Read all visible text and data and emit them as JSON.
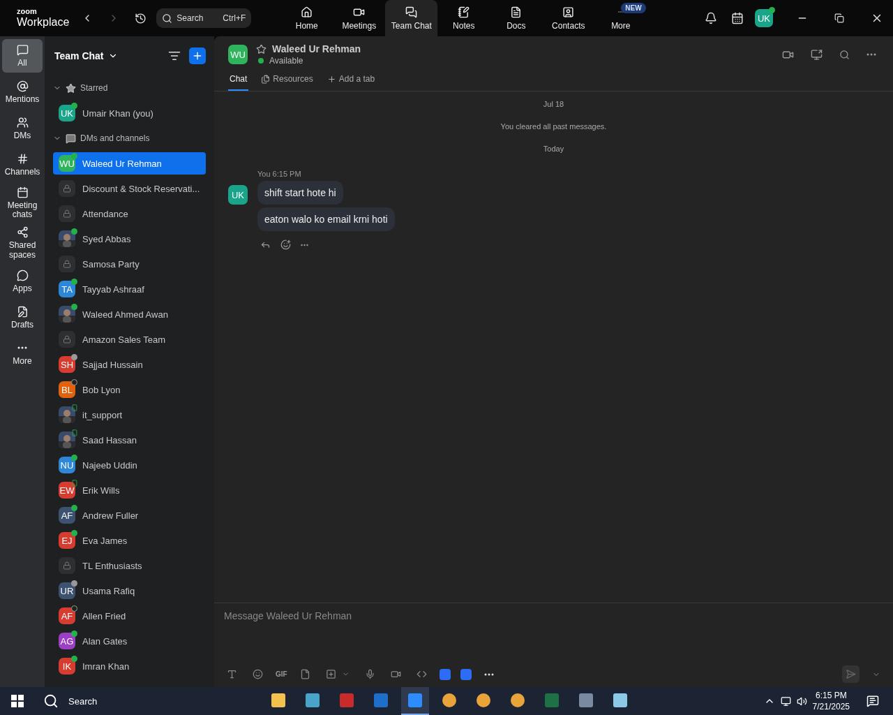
{
  "app": {
    "logo_top": "zoom",
    "logo_bottom": "Workplace"
  },
  "search": {
    "placeholder": "Search",
    "shortcut": "Ctrl+F"
  },
  "nav": [
    {
      "label": "Home",
      "selected": false
    },
    {
      "label": "Meetings",
      "selected": false
    },
    {
      "label": "Team Chat",
      "selected": true
    },
    {
      "label": "Notes",
      "selected": false
    },
    {
      "label": "Docs",
      "selected": false
    },
    {
      "label": "Contacts",
      "selected": false
    },
    {
      "label": "More",
      "selected": false,
      "badge": "NEW"
    }
  ],
  "profile": {
    "initials": "UK"
  },
  "rail": [
    {
      "label": "All",
      "selected": true
    },
    {
      "label": "Mentions",
      "selected": false
    },
    {
      "label": "DMs",
      "selected": false
    },
    {
      "label": "Channels",
      "selected": false
    },
    {
      "label": "Meeting chats",
      "selected": false
    },
    {
      "label": "Shared spaces",
      "selected": false
    },
    {
      "label": "Apps",
      "selected": false
    },
    {
      "label": "Drafts",
      "selected": false
    },
    {
      "label": "More",
      "selected": false
    }
  ],
  "sidebar": {
    "title": "Team Chat",
    "sections": [
      {
        "label": "Starred",
        "expanded": true,
        "items": [
          {
            "name": "Umair Khan (you)",
            "kind": "initials",
            "initials": "UK",
            "color": "#1aa58a",
            "presence": {
              "kind": "online"
            },
            "selected": false
          }
        ]
      },
      {
        "label": "DMs and channels",
        "expanded": true,
        "items": [
          {
            "name": "Waleed Ur Rehman",
            "kind": "initials",
            "initials": "WU",
            "color": "#2fb35c",
            "presence": {
              "kind": "online"
            },
            "selected": true
          },
          {
            "name": "Discount & Stock Reservati...",
            "kind": "channel",
            "selected": false
          },
          {
            "name": "Attendance",
            "kind": "channel",
            "selected": false
          },
          {
            "name": "Syed Abbas",
            "kind": "picture",
            "presence": {
              "kind": "online"
            },
            "selected": false
          },
          {
            "name": "Samosa Party",
            "kind": "channel",
            "selected": false
          },
          {
            "name": "Tayyab Ashraaf",
            "kind": "initials",
            "initials": "TA",
            "color": "#2d86d6",
            "presence": {
              "kind": "online"
            },
            "selected": false
          },
          {
            "name": "Waleed Ahmed Awan",
            "kind": "picture",
            "presence": {
              "kind": "online"
            },
            "selected": false
          },
          {
            "name": "Amazon Sales Team",
            "kind": "channel",
            "selected": false
          },
          {
            "name": "Sajjad Hussain",
            "kind": "initials",
            "initials": "SH",
            "color": "#d63c2f",
            "presence": {
              "kind": "away"
            },
            "selected": false
          },
          {
            "name": "Bob Lyon",
            "kind": "initials",
            "initials": "BL",
            "color": "#e0620e",
            "presence": {
              "kind": "offline"
            },
            "selected": false
          },
          {
            "name": "it_support",
            "kind": "picture",
            "presence": {
              "kind": "mobile"
            },
            "selected": false
          },
          {
            "name": "Saad Hassan",
            "kind": "picture",
            "presence": {
              "kind": "mobile"
            },
            "selected": false
          },
          {
            "name": "Najeeb Uddin",
            "kind": "initials",
            "initials": "NU",
            "color": "#2d86d6",
            "presence": {
              "kind": "online"
            },
            "selected": false
          },
          {
            "name": "Erik Wills",
            "kind": "initials",
            "initials": "EW",
            "color": "#d63c2f",
            "presence": {
              "kind": "mobile"
            },
            "selected": false
          },
          {
            "name": "Andrew Fuller",
            "kind": "initials",
            "initials": "AF",
            "color": "#3d5170",
            "presence": {
              "kind": "online"
            },
            "selected": false
          },
          {
            "name": "Eva James",
            "kind": "initials",
            "initials": "EJ",
            "color": "#d63c2f",
            "presence": {
              "kind": "online"
            },
            "selected": false
          },
          {
            "name": "TL Enthusiasts",
            "kind": "channel",
            "selected": false
          },
          {
            "name": "Usama Rafiq",
            "kind": "initials",
            "initials": "UR",
            "color": "#3d5170",
            "presence": {
              "kind": "away"
            },
            "selected": false
          },
          {
            "name": "Allen Fried",
            "kind": "initials",
            "initials": "AF",
            "color": "#d63c2f",
            "presence": {
              "kind": "offline"
            },
            "selected": false
          },
          {
            "name": "Alan Gates",
            "kind": "initials",
            "initials": "AG",
            "color": "#9b3fc4",
            "presence": {
              "kind": "online"
            },
            "selected": false
          },
          {
            "name": "Imran Khan",
            "kind": "initials",
            "initials": "IK",
            "color": "#d63c2f",
            "presence": {
              "kind": "online"
            },
            "selected": false
          }
        ]
      }
    ]
  },
  "chat": {
    "initials": "WU",
    "name": "Waleed Ur Rehman",
    "starred": false,
    "presence": "Available",
    "tabs": [
      {
        "label": "Chat",
        "selected": true
      },
      {
        "label": "Resources",
        "selected": false
      },
      {
        "label": "Add a tab",
        "selected": false
      }
    ],
    "notices": [
      "Jul 18",
      "You cleared all past messages.",
      "Today"
    ],
    "message_group": {
      "initials": "UK",
      "sender": "You",
      "time": "6:15 PM",
      "messages": [
        "shift start hote hi",
        "eaton walo ko email krni hoti"
      ]
    },
    "composer": {
      "placeholder": "Message Waleed Ur Rehman",
      "gif": "GIF"
    }
  },
  "taskbar": {
    "search": "Search",
    "time": "6:15 PM",
    "date": "7/21/2025"
  }
}
